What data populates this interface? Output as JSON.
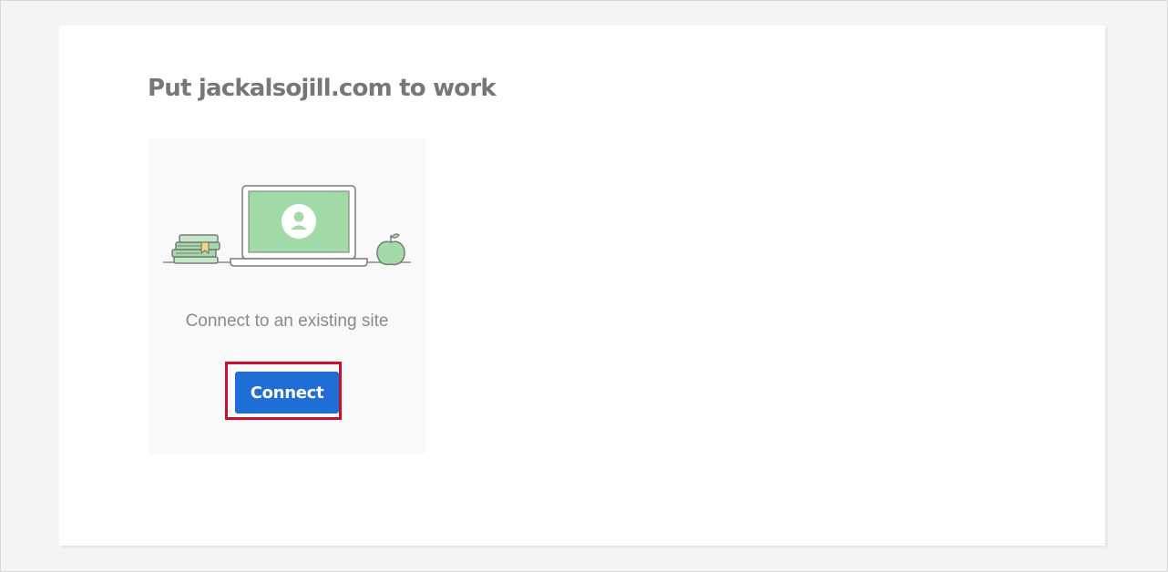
{
  "page": {
    "title": "Put jackalsojill.com to work"
  },
  "card": {
    "illustration_icon": "laptop-with-user-icon",
    "description": "Connect to an existing site",
    "connect_label": "Connect"
  },
  "colors": {
    "background": "#f5f4f2",
    "panel": "#ffffff",
    "card": "#f9f9f9",
    "title_text": "#777777",
    "button": "#1e6ed6",
    "highlight_border": "#c8102e",
    "illustration_green": "#a3dba8"
  }
}
